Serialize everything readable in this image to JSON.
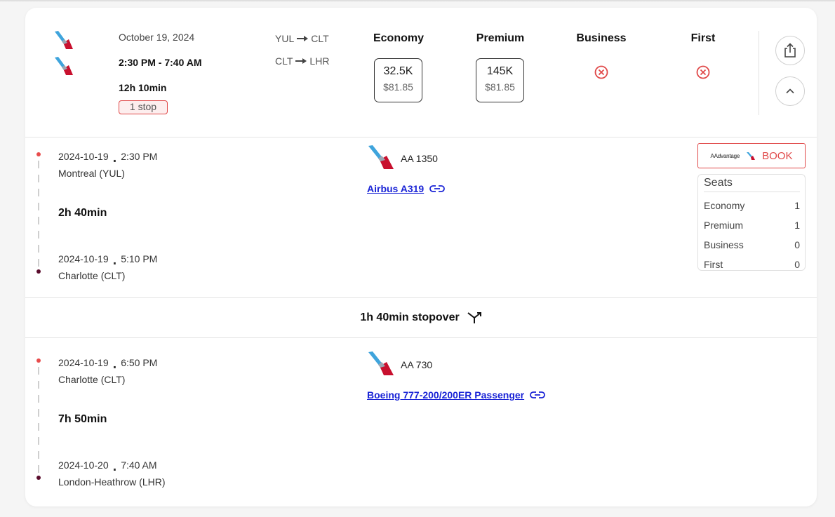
{
  "summary": {
    "date": "October 19, 2024",
    "times": "2:30 PM - 7:40 AM",
    "duration": "12h 10min",
    "stops": "1 stop",
    "routes": [
      {
        "from": "YUL",
        "to": "CLT"
      },
      {
        "from": "CLT",
        "to": "LHR"
      }
    ],
    "cabins": [
      {
        "name": "Economy",
        "miles": "32.5K",
        "cash": "$81.85",
        "available": true
      },
      {
        "name": "Premium",
        "miles": "145K",
        "cash": "$81.85",
        "available": true
      },
      {
        "name": "Business",
        "available": false
      },
      {
        "name": "First",
        "available": false
      }
    ]
  },
  "segments": [
    {
      "dep_date": "2024-10-19",
      "dep_time": "2:30 PM",
      "dep_place": "Montreal (YUL)",
      "duration": "2h 40min",
      "arr_date": "2024-10-19",
      "arr_time": "5:10 PM",
      "arr_place": "Charlotte (CLT)",
      "flight": "AA 1350",
      "aircraft": "Airbus A319"
    },
    {
      "dep_date": "2024-10-19",
      "dep_time": "6:50 PM",
      "dep_place": "Charlotte (CLT)",
      "duration": "7h 50min",
      "arr_date": "2024-10-20",
      "arr_time": "7:40 AM",
      "arr_place": "London-Heathrow (LHR)",
      "flight": "AA 730",
      "aircraft": "Boeing 777-200/200ER Passenger"
    }
  ],
  "stopover": "1h 40min stopover",
  "book": {
    "brand": "AAdvantage",
    "label": "BOOK"
  },
  "seats": {
    "title": "Seats",
    "rows": [
      {
        "cabin": "Economy",
        "count": "1"
      },
      {
        "cabin": "Premium",
        "count": "1"
      },
      {
        "cabin": "Business",
        "count": "0"
      },
      {
        "cabin": "First",
        "count": "0"
      }
    ]
  },
  "separator": ".",
  "colors": {
    "accent_red": "#e04848",
    "link_blue": "#1a24d6",
    "aa_blue": "#3fa4dc",
    "aa_red": "#c8102e",
    "dep_dot": "#e84c4c",
    "arr_dot": "#5a0c2c"
  }
}
